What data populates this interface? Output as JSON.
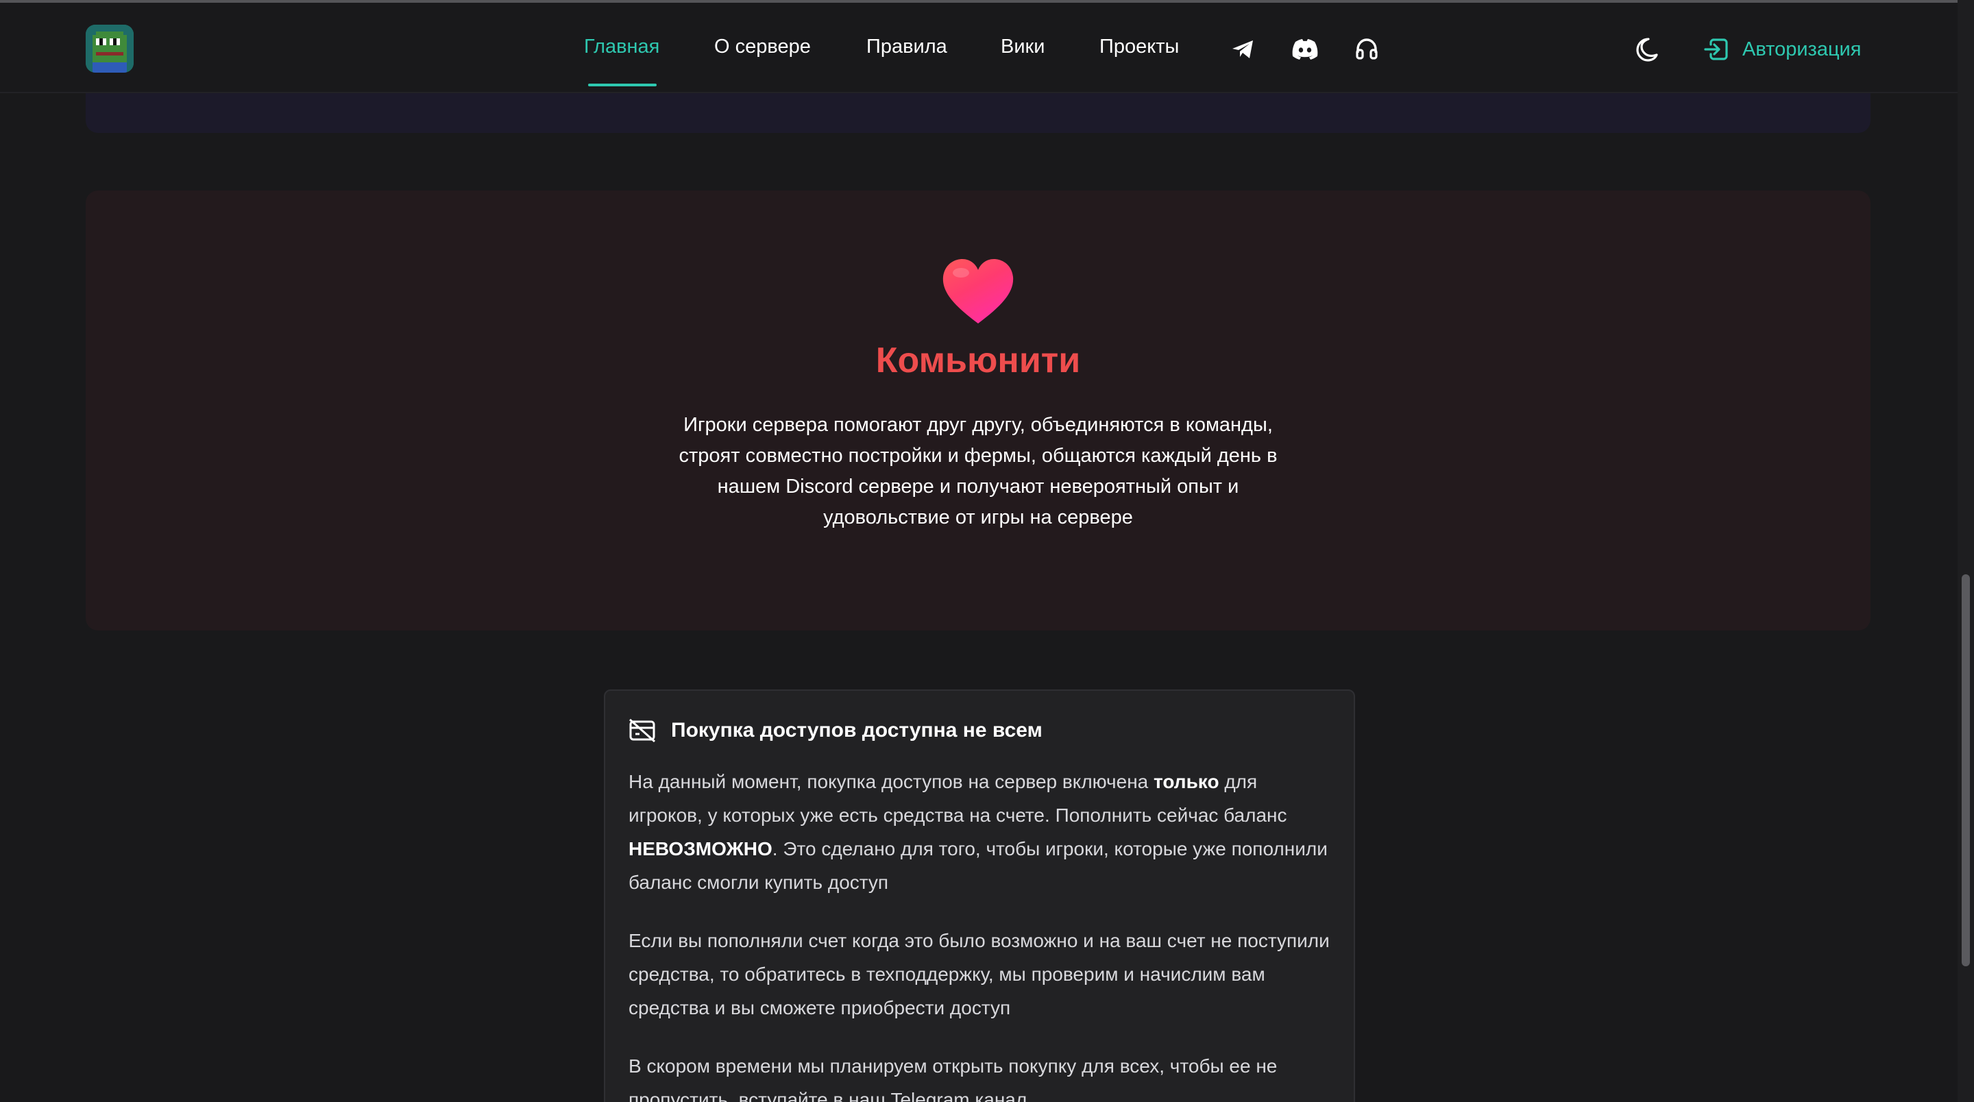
{
  "nav": {
    "items": [
      {
        "label": "Главная",
        "active": true
      },
      {
        "label": "О сервере",
        "active": false
      },
      {
        "label": "Правила",
        "active": false
      },
      {
        "label": "Вики",
        "active": false
      },
      {
        "label": "Проекты",
        "active": false
      }
    ],
    "icons": [
      "telegram-icon",
      "discord-icon",
      "headset-icon"
    ],
    "theme_icon": "moon-icon",
    "auth_label": "Авторизация",
    "auth_icon": "login-icon"
  },
  "community": {
    "icon": "heart-icon",
    "title": "Комьюнити",
    "text": "Игроки сервера помогают друг другу, объединяются в команды, строят совместно постройки и фермы, общаются каждый день в нашем Discord сервере и получают невероятный опыт и удовольствие от игры на сервере"
  },
  "notice": {
    "icon": "card-off-icon",
    "title": "Покупка доступов доступна не всем",
    "p1_before": "На данный момент, покупка доступов на сервер включена ",
    "p1_bold": "только",
    "p1_middle": " для игроков, у которых уже есть средства на счете. Пополнить сейчас баланс ",
    "p1_bold2": "НЕВОЗМОЖНО",
    "p1_after": ". Это сделано для того, чтобы игроки, которые уже пополнили баланс смогли купить доступ",
    "p2": "Если вы пополняли счет когда это было возможно и на ваш счет не поступили средства, то обратитесь в техподдержку, мы проверим и начислим вам средства и вы сможете приобрести доступ",
    "p3": "В скором времени мы планируем открыть покупку для всех, чтобы ее не пропустить, вступайте в наш Telegram канал"
  },
  "colors": {
    "accent": "#2ec8b0",
    "community_title": "#ee4d4d",
    "background": "#19191b",
    "community_bg": "#231a1d",
    "notice_bg": "#222224"
  }
}
